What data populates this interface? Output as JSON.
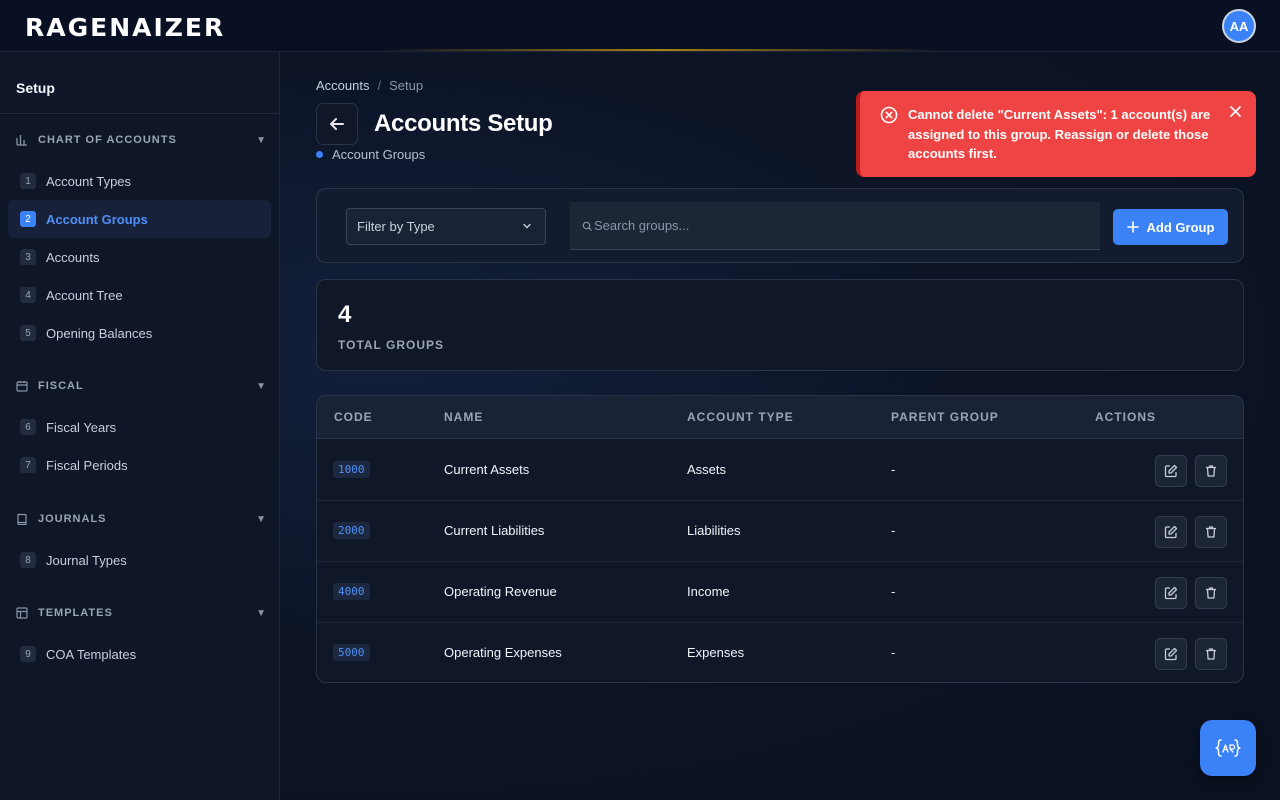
{
  "header": {
    "logo": "RAGENAIZER",
    "avatar_initials": "AA"
  },
  "sidebar": {
    "title": "Setup",
    "sections": [
      {
        "label": "CHART OF ACCOUNTS",
        "icon": "bar-chart-icon",
        "items": [
          {
            "num": "1",
            "label": "Account Types",
            "active": false
          },
          {
            "num": "2",
            "label": "Account Groups",
            "active": true
          },
          {
            "num": "3",
            "label": "Accounts",
            "active": false
          },
          {
            "num": "4",
            "label": "Account Tree",
            "active": false
          },
          {
            "num": "5",
            "label": "Opening Balances",
            "active": false
          }
        ]
      },
      {
        "label": "FISCAL",
        "icon": "calendar-icon",
        "items": [
          {
            "num": "6",
            "label": "Fiscal Years",
            "active": false
          },
          {
            "num": "7",
            "label": "Fiscal Periods",
            "active": false
          }
        ]
      },
      {
        "label": "JOURNALS",
        "icon": "book-icon",
        "items": [
          {
            "num": "8",
            "label": "Journal Types",
            "active": false
          }
        ]
      },
      {
        "label": "TEMPLATES",
        "icon": "table-icon",
        "items": [
          {
            "num": "9",
            "label": "COA Templates",
            "active": false
          }
        ]
      }
    ]
  },
  "breadcrumb": {
    "items": [
      "Accounts",
      "Setup"
    ],
    "separator": "/"
  },
  "page": {
    "title": "Accounts Setup",
    "subtitle": "Account Groups"
  },
  "toolbar": {
    "filter_placeholder": "Filter by Type",
    "search_placeholder": "Search groups...",
    "add_label": "Add Group"
  },
  "stats": {
    "value": "4",
    "label": "TOTAL GROUPS"
  },
  "table": {
    "columns": [
      "CODE",
      "NAME",
      "ACCOUNT TYPE",
      "PARENT GROUP",
      "ACTIONS"
    ],
    "rows": [
      {
        "code": "1000",
        "name": "Current Assets",
        "type": "Assets",
        "parent": "-"
      },
      {
        "code": "2000",
        "name": "Current Liabilities",
        "type": "Liabilities",
        "parent": "-"
      },
      {
        "code": "4000",
        "name": "Operating Revenue",
        "type": "Income",
        "parent": "-"
      },
      {
        "code": "5000",
        "name": "Operating Expenses",
        "type": "Expenses",
        "parent": "-"
      }
    ]
  },
  "toast": {
    "message": "Cannot delete \"Current Assets\": 1 account(s) are assigned to this group. Reassign or delete those accounts first.",
    "color": "#ef4444"
  },
  "fab": {
    "icon": "ai-assistant-icon"
  },
  "colors": {
    "accent": "#3b82f6",
    "error": "#ef4444",
    "background": "#0b1120"
  }
}
